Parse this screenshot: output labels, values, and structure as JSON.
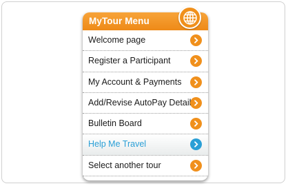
{
  "menu": {
    "title": "MyTour Menu",
    "icon": "globe-icon",
    "accent_color": "#f0901c",
    "active_color": "#2a9fd6",
    "items": [
      {
        "label": "Welcome page",
        "name": "menu-item-welcome-page",
        "active": false
      },
      {
        "label": "Register a Participant",
        "name": "menu-item-register-participant",
        "active": false
      },
      {
        "label": "My Account & Payments",
        "name": "menu-item-my-account-payments",
        "active": false
      },
      {
        "label": "Add/Revise AutoPay Details",
        "name": "menu-item-autopay-details",
        "active": false
      },
      {
        "label": "Bulletin Board",
        "name": "menu-item-bulletin-board",
        "active": false
      },
      {
        "label": "Help Me Travel",
        "name": "menu-item-help-me-travel",
        "active": true
      },
      {
        "label": "Select another tour",
        "name": "menu-item-select-another-tour",
        "active": false
      }
    ],
    "arrow_icon": "chevron-right-icon"
  }
}
